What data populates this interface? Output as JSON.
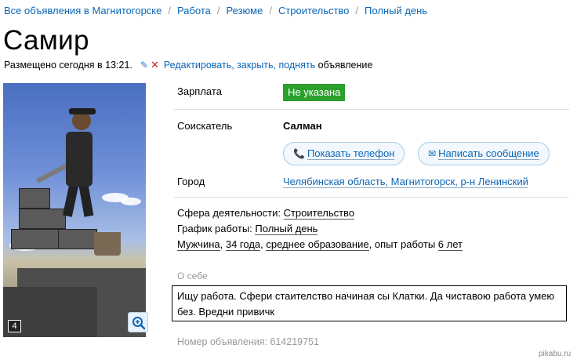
{
  "breadcrumb": [
    "Все объявления в Магнитогорске",
    "Работа",
    "Резюме",
    "Строительство",
    "Полный день"
  ],
  "title": "Самир",
  "posted": {
    "text": "Размещено сегодня в 13:21.",
    "edit_links": "Редактировать, закрыть, поднять",
    "edit_suffix": "объявление"
  },
  "photo": {
    "count": "4"
  },
  "fields": {
    "salary_label": "Зарплата",
    "salary_value": "Не указана",
    "applicant_label": "Соискатель",
    "applicant_value": "Салман",
    "show_phone": "Показать телефон",
    "send_message": "Написать сообщение",
    "city_label": "Город",
    "city_value": "Челябинская область, Магнитогорск, р-н Ленинский"
  },
  "details": {
    "sphere_label": "Сфера деятельности:",
    "sphere_value": "Строительство",
    "schedule_label": "График работы:",
    "schedule_value": "Полный день",
    "gender": "Мужчина",
    "age": "34 года",
    "education": "среднее образование",
    "experience_label": ", опыт работы ",
    "experience_value": "6 лет"
  },
  "about": {
    "label": "О себе",
    "text": "Ищу работа. Сфери стаителство начиная сы Клатки. Да чиставою работа умею без. Вредни привичк"
  },
  "ad_number": "Номер объявления: 614219751",
  "watermark": "pikabu.ru",
  "colors": {
    "link": "#0a66b7",
    "salary_badge": "#2ca02c",
    "delete": "#cc2222"
  }
}
